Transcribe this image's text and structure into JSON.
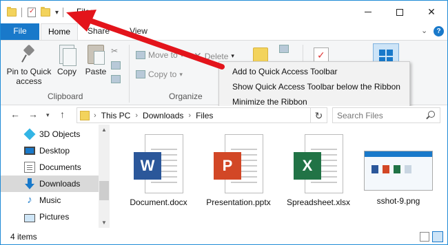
{
  "window": {
    "title": "Files"
  },
  "ribbon_tabs": [
    {
      "label": "File"
    },
    {
      "label": "Home"
    },
    {
      "label": "Share"
    },
    {
      "label": "View"
    }
  ],
  "ribbon": {
    "pin_label": "Pin to Quick access",
    "copy_label": "Copy",
    "paste_label": "Paste",
    "move_to_label": "Move to",
    "copy_to_label": "Copy to",
    "delete_label": "Delete",
    "clipboard_group": "Clipboard",
    "organize_group": "Organize"
  },
  "context_menu": {
    "items": [
      {
        "label": "Add to Quick Access Toolbar"
      },
      {
        "label": "Show Quick Access Toolbar below the Ribbon"
      },
      {
        "label": "Minimize the Ribbon"
      }
    ]
  },
  "address_bar": {
    "crumbs": [
      "This PC",
      "Downloads",
      "Files"
    ],
    "search_placeholder": "Search Files"
  },
  "sidebar": {
    "items": [
      {
        "label": "3D Objects",
        "icon": "cube-icon"
      },
      {
        "label": "Desktop",
        "icon": "desktop-icon"
      },
      {
        "label": "Documents",
        "icon": "documents-icon"
      },
      {
        "label": "Downloads",
        "icon": "download-arrow-icon",
        "selected": true
      },
      {
        "label": "Music",
        "icon": "music-note-icon"
      },
      {
        "label": "Pictures",
        "icon": "pictures-icon"
      }
    ]
  },
  "files": [
    {
      "name": "Document.docx",
      "type": "word",
      "badge": "W"
    },
    {
      "name": "Presentation.pptx",
      "type": "powerpoint",
      "badge": "P"
    },
    {
      "name": "Spreadsheet.xlsx",
      "type": "excel",
      "badge": "X"
    },
    {
      "name": "sshot-9.png",
      "type": "image"
    }
  ],
  "status": {
    "count": "4 items"
  },
  "colors": {
    "accent": "#1979ca",
    "annotation_arrow": "#e3141b",
    "word": "#2b579a",
    "powerpoint": "#d24726",
    "excel": "#217346"
  }
}
